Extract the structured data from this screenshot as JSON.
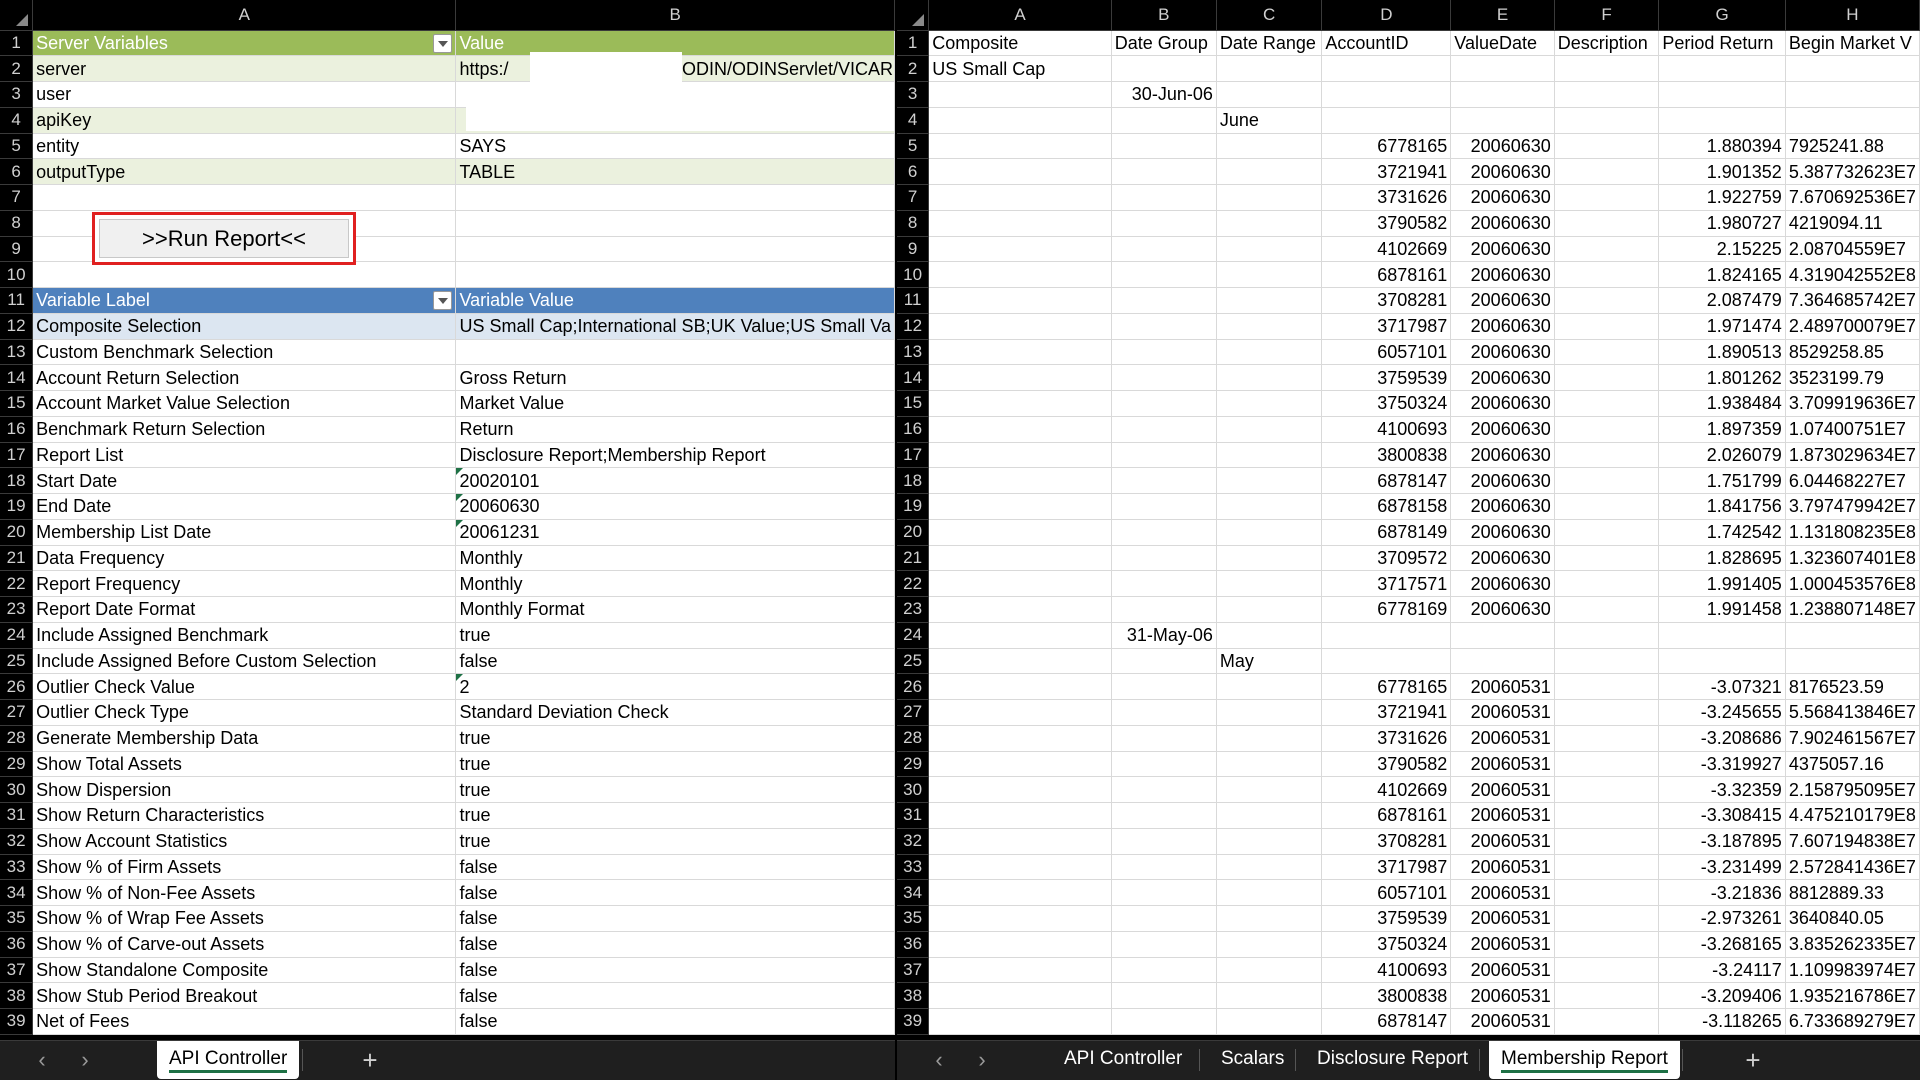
{
  "left": {
    "columns": [
      "A",
      "B"
    ],
    "rows": [
      {
        "n": "1",
        "a": "Server Variables",
        "b": "Value",
        "style": "green-hdr"
      },
      {
        "n": "2",
        "a": "server",
        "b": "https:/",
        "b2": "ODIN/ODINServlet/VICAR",
        "style": "lightgreen"
      },
      {
        "n": "3",
        "a": "user",
        "b": "",
        "style": "white"
      },
      {
        "n": "4",
        "a": "apiKey",
        "b": "",
        "style": "lightgreen"
      },
      {
        "n": "5",
        "a": "entity",
        "b": "SAYS",
        "style": "white"
      },
      {
        "n": "6",
        "a": "outputType",
        "b": "TABLE",
        "style": "lightgreen"
      },
      {
        "n": "7",
        "a": "",
        "b": "",
        "style": "white"
      },
      {
        "n": "8",
        "a": "",
        "b": "",
        "style": "white"
      },
      {
        "n": "9",
        "a": "",
        "b": "",
        "style": "white"
      },
      {
        "n": "10",
        "a": "",
        "b": "",
        "style": "white"
      },
      {
        "n": "11",
        "a": "Variable Label",
        "b": "Variable Value",
        "style": "blue-hdr"
      },
      {
        "n": "12",
        "a": "Composite Selection",
        "b": "US Small Cap;International SB;UK Value;US Small Va",
        "style": "lightblue"
      },
      {
        "n": "13",
        "a": "Custom Benchmark Selection",
        "b": "",
        "style": "white"
      },
      {
        "n": "14",
        "a": "Account Return Selection",
        "b": "Gross Return",
        "style": "white"
      },
      {
        "n": "15",
        "a": "Account Market Value Selection",
        "b": "Market Value",
        "style": "white"
      },
      {
        "n": "16",
        "a": "Benchmark Return Selection",
        "b": "Return",
        "style": "white"
      },
      {
        "n": "17",
        "a": "Report List",
        "b": "Disclosure Report;Membership Report",
        "style": "white"
      },
      {
        "n": "18",
        "a": "Start Date",
        "b": "20020101",
        "style": "white",
        "tick": true
      },
      {
        "n": "19",
        "a": "End Date",
        "b": "20060630",
        "style": "white",
        "tick": true
      },
      {
        "n": "20",
        "a": "Membership List Date",
        "b": "20061231",
        "style": "white",
        "tick": true
      },
      {
        "n": "21",
        "a": "Data Frequency",
        "b": "Monthly",
        "style": "white"
      },
      {
        "n": "22",
        "a": "Report Frequency",
        "b": "Monthly",
        "style": "white"
      },
      {
        "n": "23",
        "a": "Report Date Format",
        "b": "Monthly Format",
        "style": "white"
      },
      {
        "n": "24",
        "a": "Include Assigned Benchmark",
        "b": "true",
        "style": "white"
      },
      {
        "n": "25",
        "a": "Include Assigned Before Custom Selection",
        "b": "false",
        "style": "white"
      },
      {
        "n": "26",
        "a": "Outlier Check Value",
        "b": "2",
        "style": "white",
        "tick": true
      },
      {
        "n": "27",
        "a": "Outlier Check Type",
        "b": "Standard Deviation Check",
        "style": "white"
      },
      {
        "n": "28",
        "a": "Generate Membership Data",
        "b": "true",
        "style": "white"
      },
      {
        "n": "29",
        "a": "Show Total Assets",
        "b": "true",
        "style": "white"
      },
      {
        "n": "30",
        "a": "Show Dispersion",
        "b": "true",
        "style": "white"
      },
      {
        "n": "31",
        "a": "Show Return Characteristics",
        "b": "true",
        "style": "white"
      },
      {
        "n": "32",
        "a": "Show Account Statistics",
        "b": "true",
        "style": "white"
      },
      {
        "n": "33",
        "a": "Show % of Firm Assets",
        "b": "false",
        "style": "white"
      },
      {
        "n": "34",
        "a": "Show % of Non-Fee Assets",
        "b": "false",
        "style": "white"
      },
      {
        "n": "35",
        "a": "Show % of Wrap Fee Assets",
        "b": "false",
        "style": "white"
      },
      {
        "n": "36",
        "a": "Show % of Carve-out Assets",
        "b": "false",
        "style": "white"
      },
      {
        "n": "37",
        "a": "Show Standalone Composite",
        "b": "false",
        "style": "white"
      },
      {
        "n": "38",
        "a": "Show Stub Period Breakout",
        "b": "false",
        "style": "white"
      },
      {
        "n": "39",
        "a": "Net of Fees",
        "b": "false",
        "style": "white"
      }
    ],
    "run_report_label": ">>Run Report<<",
    "tabs": [
      {
        "label": "API Controller",
        "active": true
      }
    ]
  },
  "right": {
    "columns": [
      "A",
      "B",
      "C",
      "D",
      "E",
      "F",
      "G",
      "H"
    ],
    "rows": [
      [
        "1",
        "Composite",
        "Date Group",
        "Date Range",
        "AccountID",
        "ValueDate",
        "Description",
        "Period Return",
        "Begin Market V"
      ],
      [
        "2",
        "US Small Cap",
        "",
        "",
        "",
        "",
        "",
        "",
        ""
      ],
      [
        "3",
        "",
        "30-Jun-06",
        "",
        "",
        "",
        "",
        "",
        ""
      ],
      [
        "4",
        "",
        "",
        "June",
        "",
        "",
        "",
        "",
        ""
      ],
      [
        "5",
        "",
        "",
        "",
        "6778165",
        "20060630",
        "",
        "1.880394",
        "7925241.88"
      ],
      [
        "6",
        "",
        "",
        "",
        "3721941",
        "20060630",
        "",
        "1.901352",
        "5.387732623E7"
      ],
      [
        "7",
        "",
        "",
        "",
        "3731626",
        "20060630",
        "",
        "1.922759",
        "7.670692536E7"
      ],
      [
        "8",
        "",
        "",
        "",
        "3790582",
        "20060630",
        "",
        "1.980727",
        "4219094.11"
      ],
      [
        "9",
        "",
        "",
        "",
        "4102669",
        "20060630",
        "",
        "2.15225",
        "2.08704559E7"
      ],
      [
        "10",
        "",
        "",
        "",
        "6878161",
        "20060630",
        "",
        "1.824165",
        "4.319042552E8"
      ],
      [
        "11",
        "",
        "",
        "",
        "3708281",
        "20060630",
        "",
        "2.087479",
        "7.364685742E7"
      ],
      [
        "12",
        "",
        "",
        "",
        "3717987",
        "20060630",
        "",
        "1.971474",
        "2.489700079E7"
      ],
      [
        "13",
        "",
        "",
        "",
        "6057101",
        "20060630",
        "",
        "1.890513",
        "8529258.85"
      ],
      [
        "14",
        "",
        "",
        "",
        "3759539",
        "20060630",
        "",
        "1.801262",
        "3523199.79"
      ],
      [
        "15",
        "",
        "",
        "",
        "3750324",
        "20060630",
        "",
        "1.938484",
        "3.709919636E7"
      ],
      [
        "16",
        "",
        "",
        "",
        "4100693",
        "20060630",
        "",
        "1.897359",
        "1.07400751E7"
      ],
      [
        "17",
        "",
        "",
        "",
        "3800838",
        "20060630",
        "",
        "2.026079",
        "1.873029634E7"
      ],
      [
        "18",
        "",
        "",
        "",
        "6878147",
        "20060630",
        "",
        "1.751799",
        "6.04468227E7"
      ],
      [
        "19",
        "",
        "",
        "",
        "6878158",
        "20060630",
        "",
        "1.841756",
        "3.797479942E7"
      ],
      [
        "20",
        "",
        "",
        "",
        "6878149",
        "20060630",
        "",
        "1.742542",
        "1.131808235E8"
      ],
      [
        "21",
        "",
        "",
        "",
        "3709572",
        "20060630",
        "",
        "1.828695",
        "1.323607401E8"
      ],
      [
        "22",
        "",
        "",
        "",
        "3717571",
        "20060630",
        "",
        "1.991405",
        "1.000453576E8"
      ],
      [
        "23",
        "",
        "",
        "",
        "6778169",
        "20060630",
        "",
        "1.991458",
        "1.238807148E7"
      ],
      [
        "24",
        "",
        "31-May-06",
        "",
        "",
        "",
        "",
        "",
        ""
      ],
      [
        "25",
        "",
        "",
        "May",
        "",
        "",
        "",
        "",
        ""
      ],
      [
        "26",
        "",
        "",
        "",
        "6778165",
        "20060531",
        "",
        "-3.07321",
        "8176523.59"
      ],
      [
        "27",
        "",
        "",
        "",
        "3721941",
        "20060531",
        "",
        "-3.245655",
        "5.568413846E7"
      ],
      [
        "28",
        "",
        "",
        "",
        "3731626",
        "20060531",
        "",
        "-3.208686",
        "7.902461567E7"
      ],
      [
        "29",
        "",
        "",
        "",
        "3790582",
        "20060531",
        "",
        "-3.319927",
        "4375057.16"
      ],
      [
        "30",
        "",
        "",
        "",
        "4102669",
        "20060531",
        "",
        "-3.32359",
        "2.158795095E7"
      ],
      [
        "31",
        "",
        "",
        "",
        "6878161",
        "20060531",
        "",
        "-3.308415",
        "4.475210179E8"
      ],
      [
        "32",
        "",
        "",
        "",
        "3708281",
        "20060531",
        "",
        "-3.187895",
        "7.607194838E7"
      ],
      [
        "33",
        "",
        "",
        "",
        "3717987",
        "20060531",
        "",
        "-3.231499",
        "2.572841436E7"
      ],
      [
        "34",
        "",
        "",
        "",
        "6057101",
        "20060531",
        "",
        "-3.21836",
        "8812889.33"
      ],
      [
        "35",
        "",
        "",
        "",
        "3759539",
        "20060531",
        "",
        "-2.973261",
        "3640840.05"
      ],
      [
        "36",
        "",
        "",
        "",
        "3750324",
        "20060531",
        "",
        "-3.268165",
        "3.835262335E7"
      ],
      [
        "37",
        "",
        "",
        "",
        "4100693",
        "20060531",
        "",
        "-3.24117",
        "1.109983974E7"
      ],
      [
        "38",
        "",
        "",
        "",
        "3800838",
        "20060531",
        "",
        "-3.209406",
        "1.935216786E7"
      ],
      [
        "39",
        "",
        "",
        "",
        "6878147",
        "20060531",
        "",
        "-3.118265",
        "6.733689279E7"
      ]
    ],
    "tabs": [
      {
        "label": "API Controller",
        "active": false
      },
      {
        "label": "Scalars",
        "active": false
      },
      {
        "label": "Disclosure Report",
        "active": false
      },
      {
        "label": "Membership Report",
        "active": true
      }
    ]
  },
  "colors": {
    "green_header": "#9bbb59",
    "blue_header": "#4f81bd",
    "light_green_row": "#ebf1de",
    "light_blue_row": "#dce6f1",
    "run_button_border": "#e02020",
    "active_tab_underline": "#1e7145"
  }
}
